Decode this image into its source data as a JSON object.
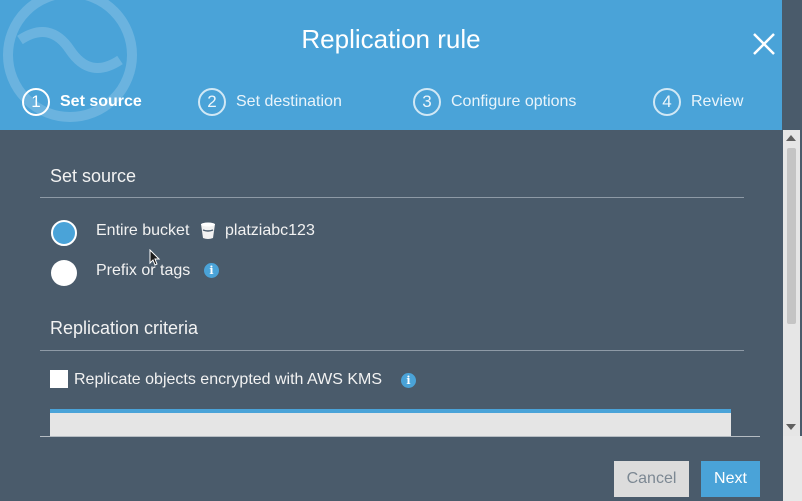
{
  "dialog": {
    "title": "Replication rule"
  },
  "steps": [
    {
      "number": "1",
      "label": "Set source",
      "active": true
    },
    {
      "number": "2",
      "label": "Set destination",
      "active": false
    },
    {
      "number": "3",
      "label": "Configure options",
      "active": false
    },
    {
      "number": "4",
      "label": "Review",
      "active": false
    }
  ],
  "source_section": {
    "title": "Set source",
    "options": [
      {
        "label": "Entire bucket",
        "selected": true,
        "bucket_icon": "bucket-icon",
        "bucket_name": "platziabc123"
      },
      {
        "label": "Prefix or tags",
        "selected": false,
        "info_icon": "info-icon"
      }
    ]
  },
  "criteria_section": {
    "title": "Replication criteria",
    "checkbox_label": "Replicate objects encrypted with AWS KMS",
    "checked": false,
    "info_icon": "info-icon"
  },
  "buttons": {
    "cancel": "Cancel",
    "next": "Next"
  },
  "colors": {
    "header": "#4aa3d8",
    "body": "#4a5b6b",
    "accent": "#4aa3d8"
  }
}
